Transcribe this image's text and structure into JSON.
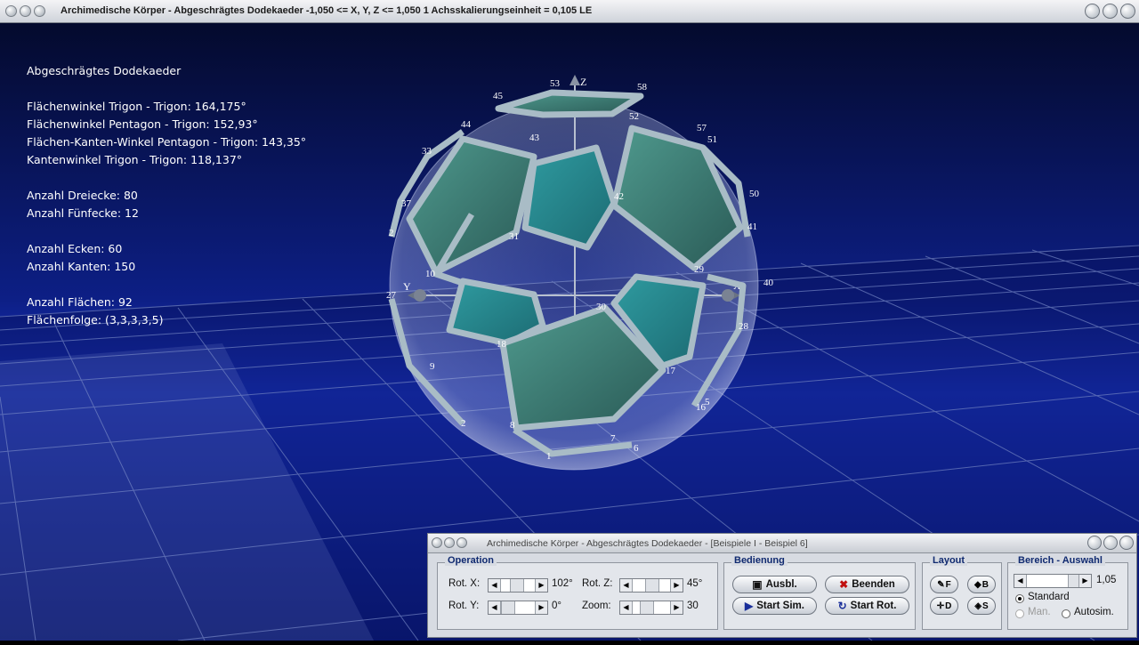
{
  "window": {
    "title": "Archimedische Körper - Abgeschrägtes Dodekaeder    -1,050 <= X, Y, Z <= 1,050    1 Achsskalierungseinheit = 0,105 LE"
  },
  "info": {
    "heading": "Abgeschrägtes Dodekaeder",
    "angles": [
      "Flächenwinkel Trigon - Trigon: 164,175°",
      "Flächenwinkel Pentagon - Trigon: 152,93°",
      "Flächen-Kanten-Winkel Pentagon - Trigon: 143,35°",
      "Kantenwinkel Trigon - Trigon: 118,137°"
    ],
    "faces_counts": [
      "Anzahl Dreiecke: 80",
      "Anzahl Fünfecke: 12"
    ],
    "vertex_edge_counts": [
      "Anzahl Ecken: 60",
      "Anzahl Kanten: 150"
    ],
    "face_info": [
      "Anzahl Flächen: 92",
      "Flächenfolge: (3,3,3,3,5)"
    ]
  },
  "axes": {
    "x": "X",
    "y": "Y",
    "z": "Z"
  },
  "vertex_labels": [
    "53",
    "58",
    "45",
    "52",
    "57",
    "51",
    "44",
    "43",
    "33",
    "42",
    "50",
    "37",
    "41",
    "2",
    "31",
    "29",
    "10",
    "40",
    "27",
    "30",
    "28",
    "18",
    "9",
    "17",
    "16",
    "5",
    "2",
    "8",
    "7",
    "6",
    "1"
  ],
  "panel": {
    "title": "Archimedische Körper - Abgeschrägtes Dodekaeder - [Beispiele I - Beispiel 6]",
    "operation": {
      "label": "Operation",
      "rot_x_label": "Rot. X:",
      "rot_x_value": "102°",
      "rot_y_label": "Rot. Y:",
      "rot_y_value": "0°",
      "rot_z_label": "Rot. Z:",
      "rot_z_value": "45°",
      "zoom_label": "Zoom:",
      "zoom_value": "30"
    },
    "bedienung": {
      "label": "Bedienung",
      "ausbl": "Ausbl.",
      "beenden": "Beenden",
      "start_sim": "Start Sim.",
      "start_rot": "Start Rot."
    },
    "layout": {
      "label": "Layout",
      "f": "F",
      "b": "B",
      "d": "D",
      "s": "S"
    },
    "bereich": {
      "label": "Bereich - Auswahl",
      "value": "1,05",
      "standard": "Standard",
      "man": "Man.",
      "autosim": "Autosim."
    }
  },
  "colors": {
    "face": "#3f7f75",
    "edge": "#a8b9c2",
    "sky_top": "#050c33",
    "sky_bottom": "#1733c6"
  }
}
